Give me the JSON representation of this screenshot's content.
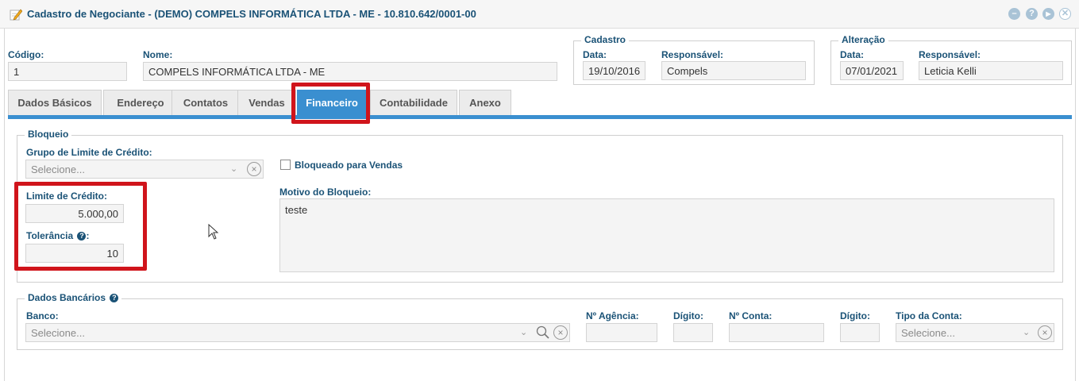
{
  "window": {
    "title": "Cadastro de Negociante - (DEMO) COMPELS INFORMÁTICA LTDA - ME - 10.810.642/0001-00",
    "buttons": {
      "minimize": "–",
      "help": "?",
      "next": "▶",
      "close": "✕"
    }
  },
  "header": {
    "codigo_label": "Código:",
    "codigo_value": "1",
    "nome_label": "Nome:",
    "nome_value": "COMPELS INFORMÁTICA LTDA - ME",
    "cadastro": {
      "legend": "Cadastro",
      "data_label": "Data:",
      "data_value": "19/10/2016",
      "responsavel_label": "Responsável:",
      "responsavel_value": "Compels"
    },
    "alteracao": {
      "legend": "Alteração",
      "data_label": "Data:",
      "data_value": "07/01/2021",
      "responsavel_label": "Responsável:",
      "responsavel_value": "Leticia Kelli"
    }
  },
  "tabs": [
    {
      "label": "Dados Básicos",
      "active": false
    },
    {
      "label": "Endereço",
      "active": false
    },
    {
      "label": "Contatos",
      "active": false
    },
    {
      "label": "Vendas",
      "active": false
    },
    {
      "label": "Financeiro",
      "active": true
    },
    {
      "label": "Contabilidade",
      "active": false
    },
    {
      "label": "Anexo",
      "active": false
    }
  ],
  "bloqueio": {
    "legend": "Bloqueio",
    "grupo_label": "Grupo de Limite de Crédito:",
    "grupo_placeholder": "Selecione...",
    "bloqueado_label": "Bloqueado para Vendas",
    "bloqueado_checked": false,
    "motivo_label": "Motivo do Bloqueio:",
    "motivo_value": "teste",
    "limite_label": "Limite de Crédito:",
    "limite_value": "5.000,00",
    "tolerancia_label": "Tolerância",
    "tolerancia_suffix": ":",
    "tolerancia_value": "10"
  },
  "bancarios": {
    "legend": "Dados Bancários",
    "banco_label": "Banco:",
    "banco_placeholder": "Selecione...",
    "agencia_label": "Nº Agência:",
    "agencia_value": "",
    "digito1_label": "Dígito:",
    "digito1_value": "",
    "conta_label": "Nº Conta:",
    "conta_value": "",
    "digito2_label": "Dígito:",
    "digito2_value": "",
    "tipo_label": "Tipo da Conta:",
    "tipo_placeholder": "Selecione..."
  },
  "colors": {
    "accent": "#3a8fd0",
    "label": "#1a5276",
    "highlight": "#d0141b"
  },
  "icons": {
    "title": "edit-pencil-icon",
    "cursor": "mouse-pointer-icon"
  }
}
